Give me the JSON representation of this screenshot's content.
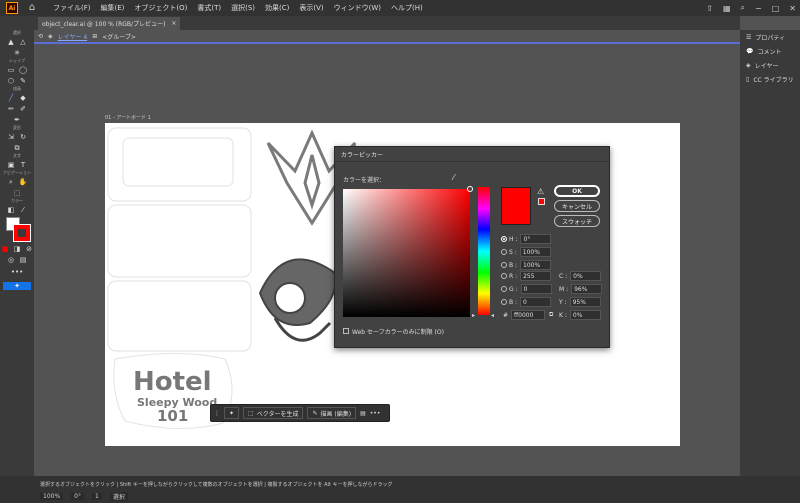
{
  "app": {
    "logo": "Ai"
  },
  "menubar": {
    "items": [
      "ファイル(F)",
      "編集(E)",
      "オブジェクト(O)",
      "書式(T)",
      "選択(S)",
      "効果(C)",
      "表示(V)",
      "ウィンドウ(W)",
      "ヘルプ(H)"
    ]
  },
  "tab": {
    "title": "object_clear.ai @ 100 % (RGB/プレビュー)",
    "close": "×"
  },
  "breadcrumb": {
    "layer": "レイヤー 4",
    "group": "<グループ>"
  },
  "toolbar": {
    "groups": [
      "選択",
      "シェイプ",
      "描画",
      "変形",
      "文字",
      "ナビゲーション",
      "カラー"
    ]
  },
  "right_panel": {
    "items": [
      "プロパティ",
      "コメント",
      "レイヤー",
      "CC ライブラリ"
    ]
  },
  "artboard": {
    "label": "01 - アートボード 1"
  },
  "artwork": {
    "hotel_line1": "Hotel",
    "hotel_line2": "Sleepy Wood",
    "hotel_line3": "101"
  },
  "color_picker": {
    "title": "カラーピッカー",
    "select_label": "カラーを選択：",
    "buttons": {
      "ok": "OK",
      "cancel": "キャンセル",
      "swatches": "スウォッチ"
    },
    "hsb": [
      {
        "label": "H :",
        "value": "0°",
        "selected": true
      },
      {
        "label": "S :",
        "value": "100%",
        "selected": false
      },
      {
        "label": "B :",
        "value": "100%",
        "selected": false
      }
    ],
    "rgb": [
      {
        "label": "R :",
        "value": "255"
      },
      {
        "label": "G :",
        "value": "0"
      },
      {
        "label": "B :",
        "value": "0"
      }
    ],
    "cmyk": [
      {
        "label": "C :",
        "value": "0%"
      },
      {
        "label": "M :",
        "value": "96%"
      },
      {
        "label": "Y :",
        "value": "95%"
      },
      {
        "label": "K :",
        "value": "0%"
      }
    ],
    "hex_label": "#",
    "hex_value": "ff0000",
    "web_safe_label": "Web セーフカラーのみに制限 (O)",
    "current_color": "#ff0000"
  },
  "context_bar": {
    "vectorize": "ベクターを生成",
    "edit": "描画 (編集)",
    "more": "•••"
  },
  "status": {
    "message": "選択するオブジェクトをクリック  |  Shift キーを押しながらクリックして複数のオブジェクトを選択  |  複製するオブジェクトを Alt キーを押しながらドラッグ",
    "zoom": "100%",
    "rotation": "0°",
    "artboard_num": "1",
    "tool": "選択"
  }
}
